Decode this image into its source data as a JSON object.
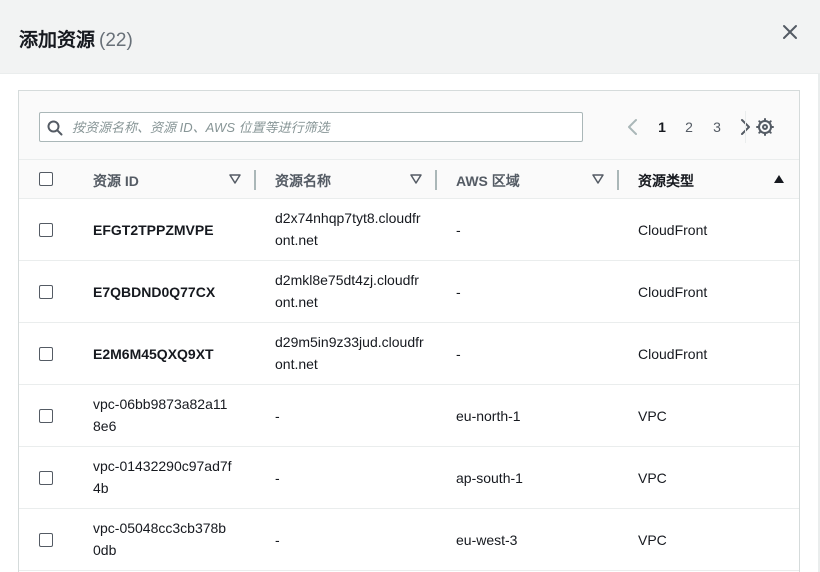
{
  "modal": {
    "title": "添加资源",
    "count": "(22)"
  },
  "search": {
    "placeholder": "按资源名称、资源 ID、AWS 位置等进行筛选",
    "value": ""
  },
  "pagination": {
    "current_page": 1,
    "pages": [
      "1",
      "2",
      "3"
    ]
  },
  "table": {
    "columns": [
      {
        "label": "资源 ID",
        "sort": "sortable"
      },
      {
        "label": "资源名称",
        "sort": "sortable"
      },
      {
        "label": "AWS 区域",
        "sort": "sortable"
      },
      {
        "label": "资源类型",
        "sort": "ascending"
      }
    ],
    "rows": [
      {
        "id": "EFGT2TPPZMVPE",
        "name": "d2x74nhqp7tyt8.cloudfront.net",
        "region": "-",
        "type": "CloudFront",
        "checked": false
      },
      {
        "id": "E7QBDND0Q77CX",
        "name": "d2mkl8e75dt4zj.cloudfront.net",
        "region": "-",
        "type": "CloudFront",
        "checked": false
      },
      {
        "id": "E2M6M45QXQ9XT",
        "name": "d29m5in9z33jud.cloudfront.net",
        "region": "-",
        "type": "CloudFront",
        "checked": false
      },
      {
        "id": "vpc-06bb9873a82a118e6",
        "name": "-",
        "region": "eu-north-1",
        "type": "VPC",
        "checked": false
      },
      {
        "id": "vpc-01432290c97ad7f4b",
        "name": "-",
        "region": "ap-south-1",
        "type": "VPC",
        "checked": false
      },
      {
        "id": "vpc-05048cc3cb378b0db",
        "name": "-",
        "region": "eu-west-3",
        "type": "VPC",
        "checked": false
      }
    ]
  },
  "icons": {
    "close": "close-icon",
    "search": "search-icon",
    "prev": "chevron-left-icon",
    "next": "chevron-right-icon",
    "settings": "gear-icon",
    "sort": "caret-down-icon",
    "sort_asc": "caret-up-icon"
  },
  "colors": {
    "header_bg": "#f2f3f3",
    "text": "#16191f",
    "muted": "#687078",
    "border": "#d5dbdb"
  }
}
